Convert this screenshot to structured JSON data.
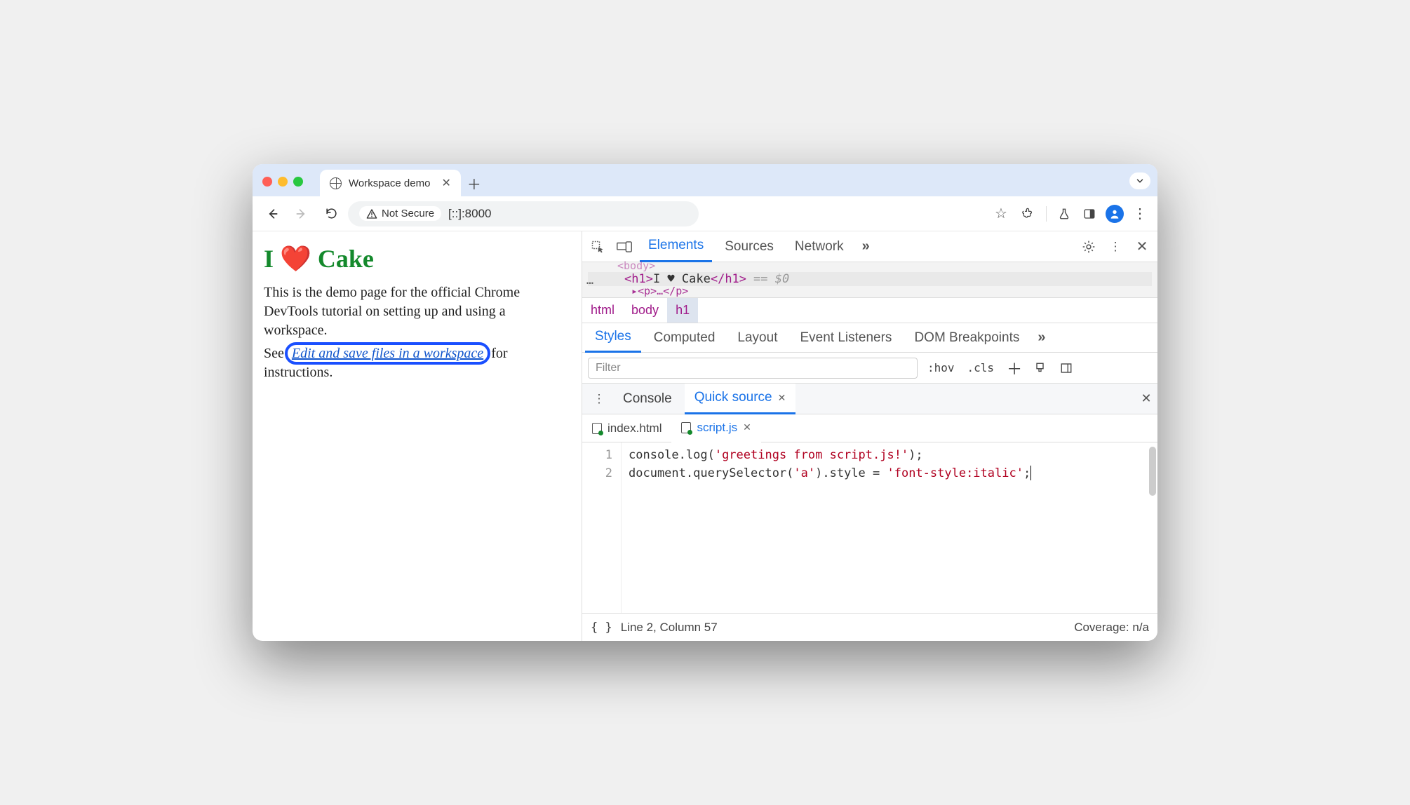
{
  "tab": {
    "title": "Workspace demo"
  },
  "urlbar": {
    "secure_label": "Not Secure",
    "url": "[::]:8000"
  },
  "page": {
    "heading": "I ❤️ Cake",
    "para1": "This is the demo page for the official Chrome DevTools tutorial on setting up and using a workspace.",
    "see_prefix": "See ",
    "link": "Edit and save files in a workspace",
    "see_suffix": " for instructions."
  },
  "devtools": {
    "tabs": {
      "elements": "Elements",
      "sources": "Sources",
      "network": "Network"
    },
    "elements": {
      "prev": "<body>",
      "sel_open": "<h1>",
      "sel_text": "I ♥ Cake",
      "sel_close": "</h1>",
      "sel_eq": "== $0",
      "next": "<p>…</p>"
    },
    "crumbs": {
      "c1": "html",
      "c2": "body",
      "c3": "h1"
    },
    "styles_tabs": {
      "styles": "Styles",
      "computed": "Computed",
      "layout": "Layout",
      "listeners": "Event Listeners",
      "dom": "DOM Breakpoints"
    },
    "styles_tools": {
      "filter_placeholder": "Filter",
      "hov": ":hov",
      "cls": ".cls"
    },
    "drawer": {
      "console": "Console",
      "quick": "Quick source"
    },
    "files": {
      "index": "index.html",
      "script": "script.js"
    },
    "code": {
      "line1_a": "console.log(",
      "line1_b": "'greetings from script.js!'",
      "line1_c": ");",
      "line2_a": "document.querySelector(",
      "line2_b": "'a'",
      "line2_c": ").style = ",
      "line2_d": "'font-style:italic'",
      "line2_e": ";",
      "ln1": "1",
      "ln2": "2"
    },
    "status": {
      "pos": "Line 2, Column 57",
      "coverage": "Coverage: n/a"
    }
  }
}
